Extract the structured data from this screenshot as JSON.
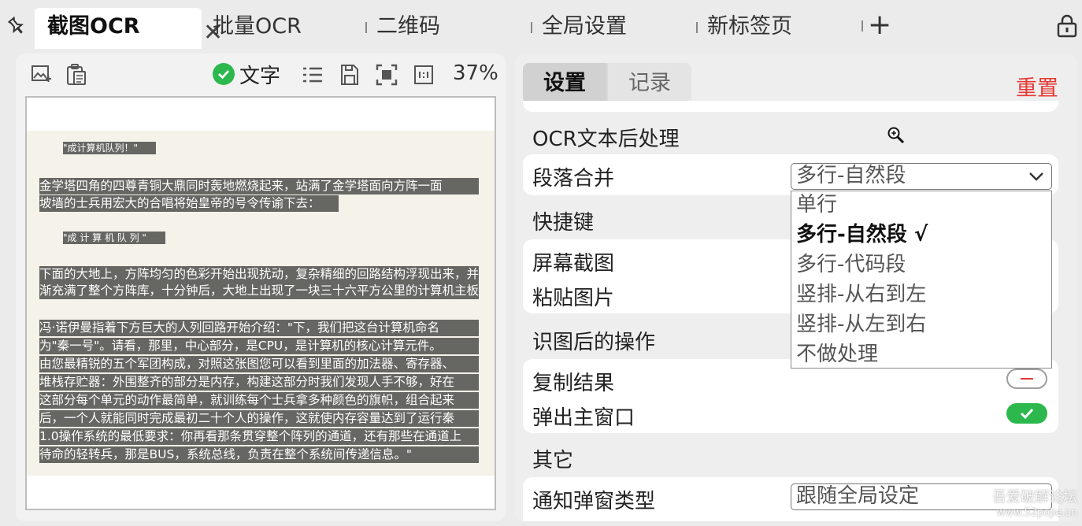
{
  "tabs": [
    {
      "label": "截图OCR",
      "active": true
    },
    {
      "label": "批量OCR",
      "active": false
    },
    {
      "label": "二维码",
      "active": false
    },
    {
      "label": "全局设置",
      "active": false
    },
    {
      "label": "新标签页",
      "active": false
    }
  ],
  "tab_close_symbol": "✕",
  "add_tab_symbol": "+",
  "toolbar": {
    "text_mode_label": "文字",
    "text_mode_checked": true,
    "zoom": "37%"
  },
  "ocr_result": {
    "heading1": "\"成计算机队列！\"",
    "para1_line1": "金学塔四角的四尊青铜大鼎同时轰地燃烧起来，站满了金学塔面向方阵一面",
    "para1_line2": "坡墙的士兵用宏大的合唱将始皇帝的号令传谕下去：",
    "heading2": "\"成 计 算 机 队 列 \"",
    "para2_line1": "下面的大地上，方阵均匀的色彩开始出现扰动，复杂精细的回路结构浮现出来，并渐",
    "para2_line2": "渐充满了整个方阵库，十分钟后，大地上出现了一块三十六平方公里的计算机主板。",
    "para3_lines": [
      "冯·诺伊曼指着下方巨大的人列回路开始介绍：\"下，我们把这台计算机命名",
      "为\"秦一号\"。请看，那里，中心部分，是CPU，是计算机的核心计算元件。",
      "由您最精锐的五个军团构成，对照这张图您可以看到里面的加法器、寄存器、",
      "堆栈存贮器：外围整齐的部分是内存，构建这部分时我们发现人手不够，好在",
      "这部分每个单元的动作最简单，就训练每个士兵拿多种颜色的旗帜，组合起来",
      "后，一个人就能同时完成最初二十个人的操作，这就使内存容量达到了运行秦",
      "1.0操作系统的最低要求：你再看那条贯穿整个阵列的通道，还有那些在通道上",
      "待命的轻转兵，那是BUS，系统总线，负责在整个系统间传递信息。\""
    ]
  },
  "settings": {
    "tab_settings": "设置",
    "tab_history": "记录",
    "reset": "重置",
    "section_post": "OCR文本后处理",
    "paragraph_merge_label": "段落合并",
    "paragraph_merge_value": "多行-自然段",
    "dropdown_options": [
      {
        "label": "单行",
        "selected": false
      },
      {
        "label": "多行-自然段 √",
        "selected": true
      },
      {
        "label": "多行-代码段",
        "selected": false
      },
      {
        "label": "竖排-从右到左",
        "selected": false
      },
      {
        "label": "竖排-从左到右",
        "selected": false
      },
      {
        "label": "不做处理",
        "selected": false
      }
    ],
    "section_hotkey": "快捷键",
    "screenshot_label": "屏幕截图",
    "paste_label": "粘贴图片",
    "section_after": "识图后的操作",
    "copy_result_label": "复制结果",
    "copy_result_on": false,
    "popup_main_label": "弹出主窗口",
    "popup_main_on": true,
    "section_other": "其它",
    "notify_type_label": "通知弹窗类型",
    "notify_type_value": "跟随全局设定"
  },
  "watermark": {
    "line1": "吾爱破解论坛",
    "line2": "www.52pojie.cn"
  },
  "colors": {
    "accent_green": "#2db84d",
    "reset_red": "#e53935",
    "highlight": "#666663"
  }
}
